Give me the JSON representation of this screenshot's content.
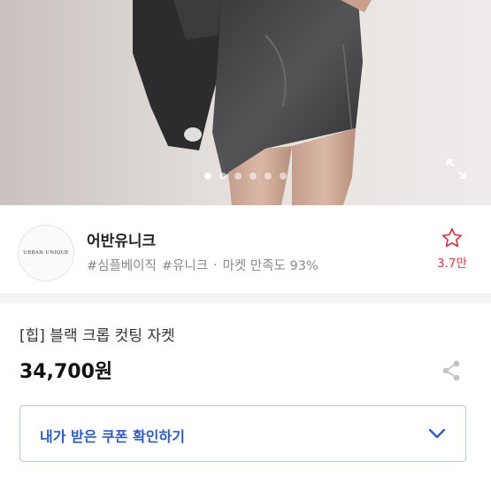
{
  "carousel": {
    "slide_count": 6,
    "active_index": 0
  },
  "seller": {
    "logo_text": "URBAN UNIQUE",
    "name": "어반유니크",
    "tags": [
      "#심플베이직",
      "#유니크"
    ],
    "separator": "·",
    "satisfaction": "마켓 만족도 93%",
    "favorite_count": "3.7만"
  },
  "product": {
    "name": "[힙] 블랙 크롭 컷팅 자켓",
    "price": "34,700원"
  },
  "coupon": {
    "label": "내가 받은 쿠폰 확인하기"
  },
  "colors": {
    "accent_blue": "#2f5bc4",
    "favorite_red": "#d83a4a"
  }
}
